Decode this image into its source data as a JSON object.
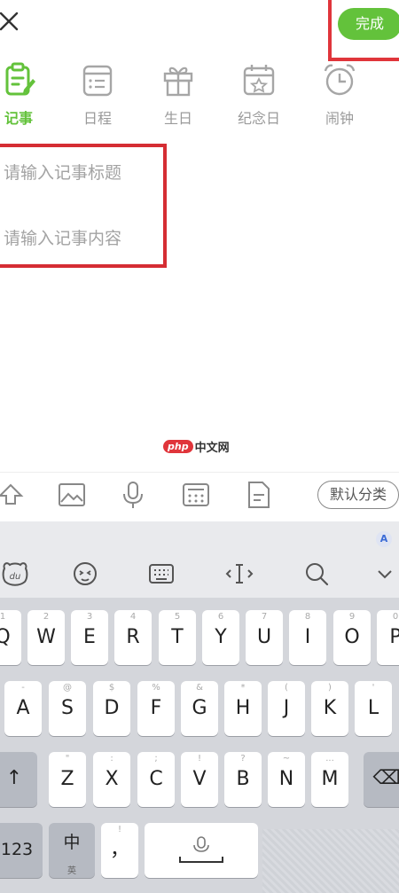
{
  "header": {
    "done_label": "完成"
  },
  "tabs": [
    {
      "label": "记事",
      "icon": "memo-icon",
      "active": true
    },
    {
      "label": "日程",
      "icon": "schedule-icon"
    },
    {
      "label": "生日",
      "icon": "gift-icon"
    },
    {
      "label": "纪念日",
      "icon": "calendar-star-icon"
    },
    {
      "label": "闹钟",
      "icon": "alarm-clock-icon"
    }
  ],
  "form": {
    "title_placeholder": "请输入记事标题",
    "content_placeholder": "请输入记事内容"
  },
  "watermark": {
    "logo": "php",
    "text": "中文网"
  },
  "toolbar": {
    "icons": [
      "expand-up-icon",
      "image-icon",
      "microphone-icon",
      "calculator-icon",
      "document-icon"
    ],
    "category_label": "默认分类"
  },
  "keyboard": {
    "row1": [
      {
        "hint": "1",
        "ch": "Q"
      },
      {
        "hint": "2",
        "ch": "W"
      },
      {
        "hint": "3",
        "ch": "E"
      },
      {
        "hint": "4",
        "ch": "R"
      },
      {
        "hint": "5",
        "ch": "T"
      },
      {
        "hint": "6",
        "ch": "Y"
      },
      {
        "hint": "7",
        "ch": "U"
      },
      {
        "hint": "8",
        "ch": "I"
      },
      {
        "hint": "9",
        "ch": "O"
      },
      {
        "hint": "0",
        "ch": "P"
      }
    ],
    "row2": [
      {
        "hint": "-",
        "ch": "A"
      },
      {
        "hint": "@",
        "ch": "S"
      },
      {
        "hint": "$",
        "ch": "D"
      },
      {
        "hint": "%",
        "ch": "F"
      },
      {
        "hint": "&",
        "ch": "G"
      },
      {
        "hint": "*",
        "ch": "H"
      },
      {
        "hint": "(",
        "ch": "J"
      },
      {
        "hint": ")",
        "ch": "K"
      },
      {
        "hint": "'",
        "ch": "L"
      }
    ],
    "row3": [
      {
        "hint": "\"",
        "ch": "Z"
      },
      {
        "hint": ":",
        "ch": "X"
      },
      {
        "hint": ";",
        "ch": "C"
      },
      {
        "hint": "!",
        "ch": "V"
      },
      {
        "hint": "?",
        "ch": "B"
      },
      {
        "hint": "~",
        "ch": "N"
      },
      {
        "hint": "...",
        "ch": "M"
      }
    ],
    "shift": "↑",
    "backspace": "⌫",
    "num_key": "123",
    "lang_key": "中",
    "lang_sub": "英",
    "punct_key": "，",
    "punct_hint": "!"
  }
}
